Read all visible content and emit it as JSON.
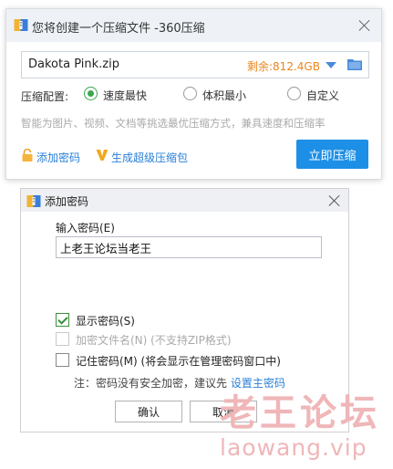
{
  "compress_window": {
    "title": "您将创建一个压缩文件 -360压缩",
    "file_name": "Dakota Pink.zip",
    "free_space": "剩余:812.4GB",
    "config_label": "压缩配置:",
    "options": [
      {
        "label": "速度最快",
        "selected": true
      },
      {
        "label": "体积最小",
        "selected": false
      },
      {
        "label": "自定义",
        "selected": false
      }
    ],
    "hint": "智能为图片、视频、文档等挑选最优压缩方式，兼具速度和压缩率",
    "add_password_link": "添加密码",
    "super_compress_link": "生成超级压缩包",
    "compress_button": "立即压缩",
    "accent": "#1d8fe6"
  },
  "password_dialog": {
    "title": "添加密码",
    "input_label": "输入密码(E)",
    "password_value": "上老王论坛当老王",
    "show_password": {
      "label": "显示密码(S)",
      "checked": true
    },
    "encrypt_names": {
      "label": "加密文件名(N) (不支持ZIP格式)",
      "checked": false,
      "disabled": true
    },
    "remember": {
      "label": "记住密码(M) (将会显示在管理密码窗口中)",
      "checked": false
    },
    "note_text": "注：密码没有安全加密，建议先 ",
    "note_link": "设置主密码",
    "ok_button": "确认",
    "cancel_button": "取消"
  },
  "watermark": {
    "line1": "老王论坛",
    "line2": "laowang.vip"
  }
}
